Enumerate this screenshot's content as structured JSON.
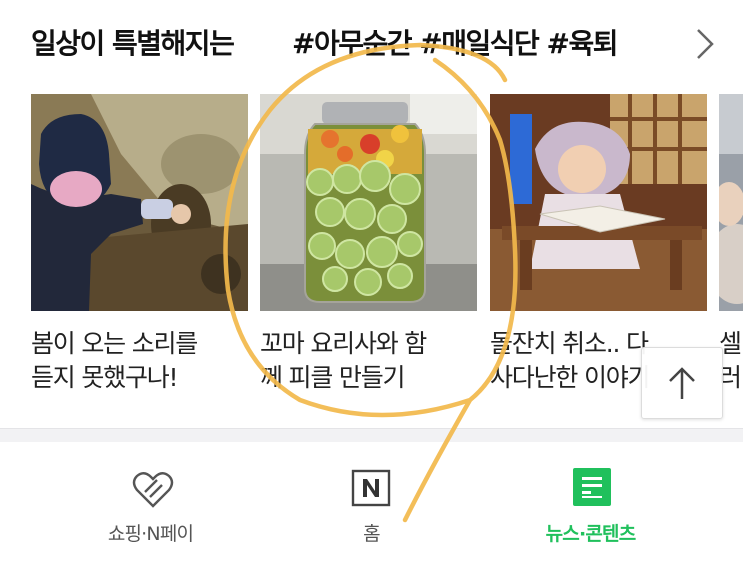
{
  "header": {
    "title": "일상이 특별해지는",
    "tags": "#아무순간 #매일식단 #육퇴"
  },
  "cards": [
    {
      "line1": "봄이 오는 소리를",
      "line2": "듣지 못했구나!"
    },
    {
      "line1": "꼬마 요리사와 함",
      "line2": "께 피클 만들기"
    },
    {
      "line1": "돌잔치 취소.. 다",
      "line2": "사다난한 이야기"
    },
    {
      "line1": "셀",
      "line2": "러"
    }
  ],
  "tabbar": {
    "tabs": [
      {
        "label": "쇼핑·N페이",
        "icon": "heart-tag-icon"
      },
      {
        "label": "홈",
        "icon": "naver-n-icon"
      },
      {
        "label": "뉴스·콘텐츠",
        "icon": "news-icon"
      }
    ],
    "active_color": "#20c05c"
  },
  "icons": {
    "more": "chevron-right-icon",
    "scroll_top": "arrow-up-icon"
  }
}
